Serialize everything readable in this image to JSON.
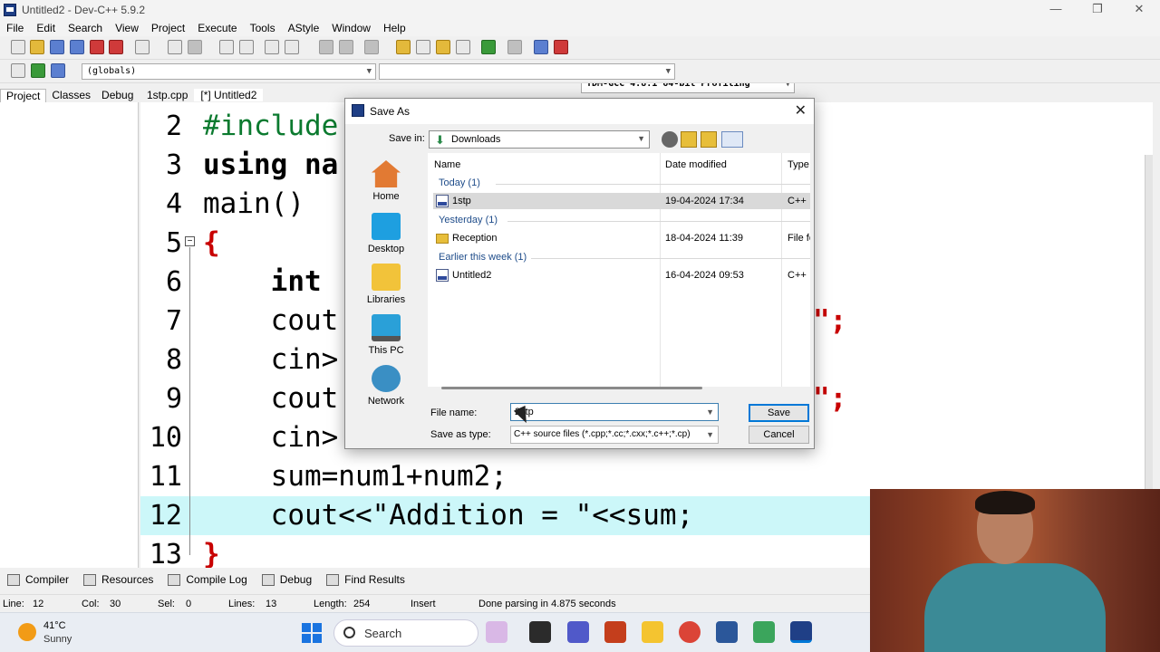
{
  "window": {
    "title": "Untitled2 - Dev-C++ 5.9.2",
    "controls": [
      "—",
      "❐",
      "✕"
    ]
  },
  "menu": [
    "File",
    "Edit",
    "Search",
    "View",
    "Project",
    "Execute",
    "Tools",
    "AStyle",
    "Window",
    "Help"
  ],
  "toolbar": {
    "compiler": "TDM-GCC 4.8.1 64-bit Profiling",
    "scope": "(globals)"
  },
  "left_tabs": [
    "Project",
    "Classes",
    "Debug"
  ],
  "file_tabs": [
    "1stp.cpp",
    "[*] Untitled2"
  ],
  "editor": {
    "lines": [
      {
        "num": "2",
        "code": "#include"
      },
      {
        "num": "3",
        "code": "using na"
      },
      {
        "num": "4",
        "code": "main()"
      },
      {
        "num": "5",
        "code": "{"
      },
      {
        "num": "6",
        "code": "    int"
      },
      {
        "num": "7",
        "code": "    cout"
      },
      {
        "num": "8",
        "code": "    cin>"
      },
      {
        "num": "9",
        "code": "    cout"
      },
      {
        "num": "10",
        "code": "    cin>"
      },
      {
        "num": "11",
        "code": "    sum=num1+num2;"
      },
      {
        "num": "12",
        "code": "    cout<<\"Addition = \"<<sum;"
      },
      {
        "num": "13",
        "code": "}"
      }
    ],
    "fragments": {
      "l7": "\";",
      "l9": "\";"
    },
    "fold_symbol": "−"
  },
  "bottom_tabs": [
    "Compiler",
    "Resources",
    "Compile Log",
    "Debug",
    "Find Results"
  ],
  "status": {
    "line_label": "Line:",
    "line": "12",
    "col_label": "Col:",
    "col": "30",
    "sel_label": "Sel:",
    "sel": "0",
    "lines_label": "Lines:",
    "lines": "13",
    "length_label": "Length:",
    "length": "254",
    "mode": "Insert",
    "message": "Done parsing in 4.875 seconds"
  },
  "taskbar": {
    "temp": "41°C",
    "weather": "Sunny",
    "search": "Search"
  },
  "dialog": {
    "title": "Save As",
    "save_in_label": "Save in:",
    "save_in": "Downloads",
    "places": [
      "Home",
      "Desktop",
      "Libraries",
      "This PC",
      "Network"
    ],
    "columns": {
      "name": "Name",
      "date": "Date modified",
      "type": "Type"
    },
    "groups": [
      "Today (1)",
      "Yesterday (1)",
      "Earlier this week (1)"
    ],
    "files": [
      {
        "name": "1stp",
        "date": "19-04-2024 17:34",
        "type": "C++"
      },
      {
        "name": "Reception",
        "date": "18-04-2024 11:39",
        "type": "File fo"
      },
      {
        "name": "Untitled2",
        "date": "16-04-2024 09:53",
        "type": "C++"
      }
    ],
    "file_name_label": "File name:",
    "file_name": "2stp",
    "save_type_label": "Save as type:",
    "save_type": "C++ source files (*.cpp;*.cc;*.cxx;*.c++;*.cp)",
    "save_button": "Save",
    "cancel_button": "Cancel"
  },
  "colors": {
    "accent": "#0078d7",
    "highlight_line": "#ccf7f9",
    "keyword_symbol": "#c80000",
    "string": "#1b3fb8",
    "preprocessor": "#0b7a2f"
  }
}
